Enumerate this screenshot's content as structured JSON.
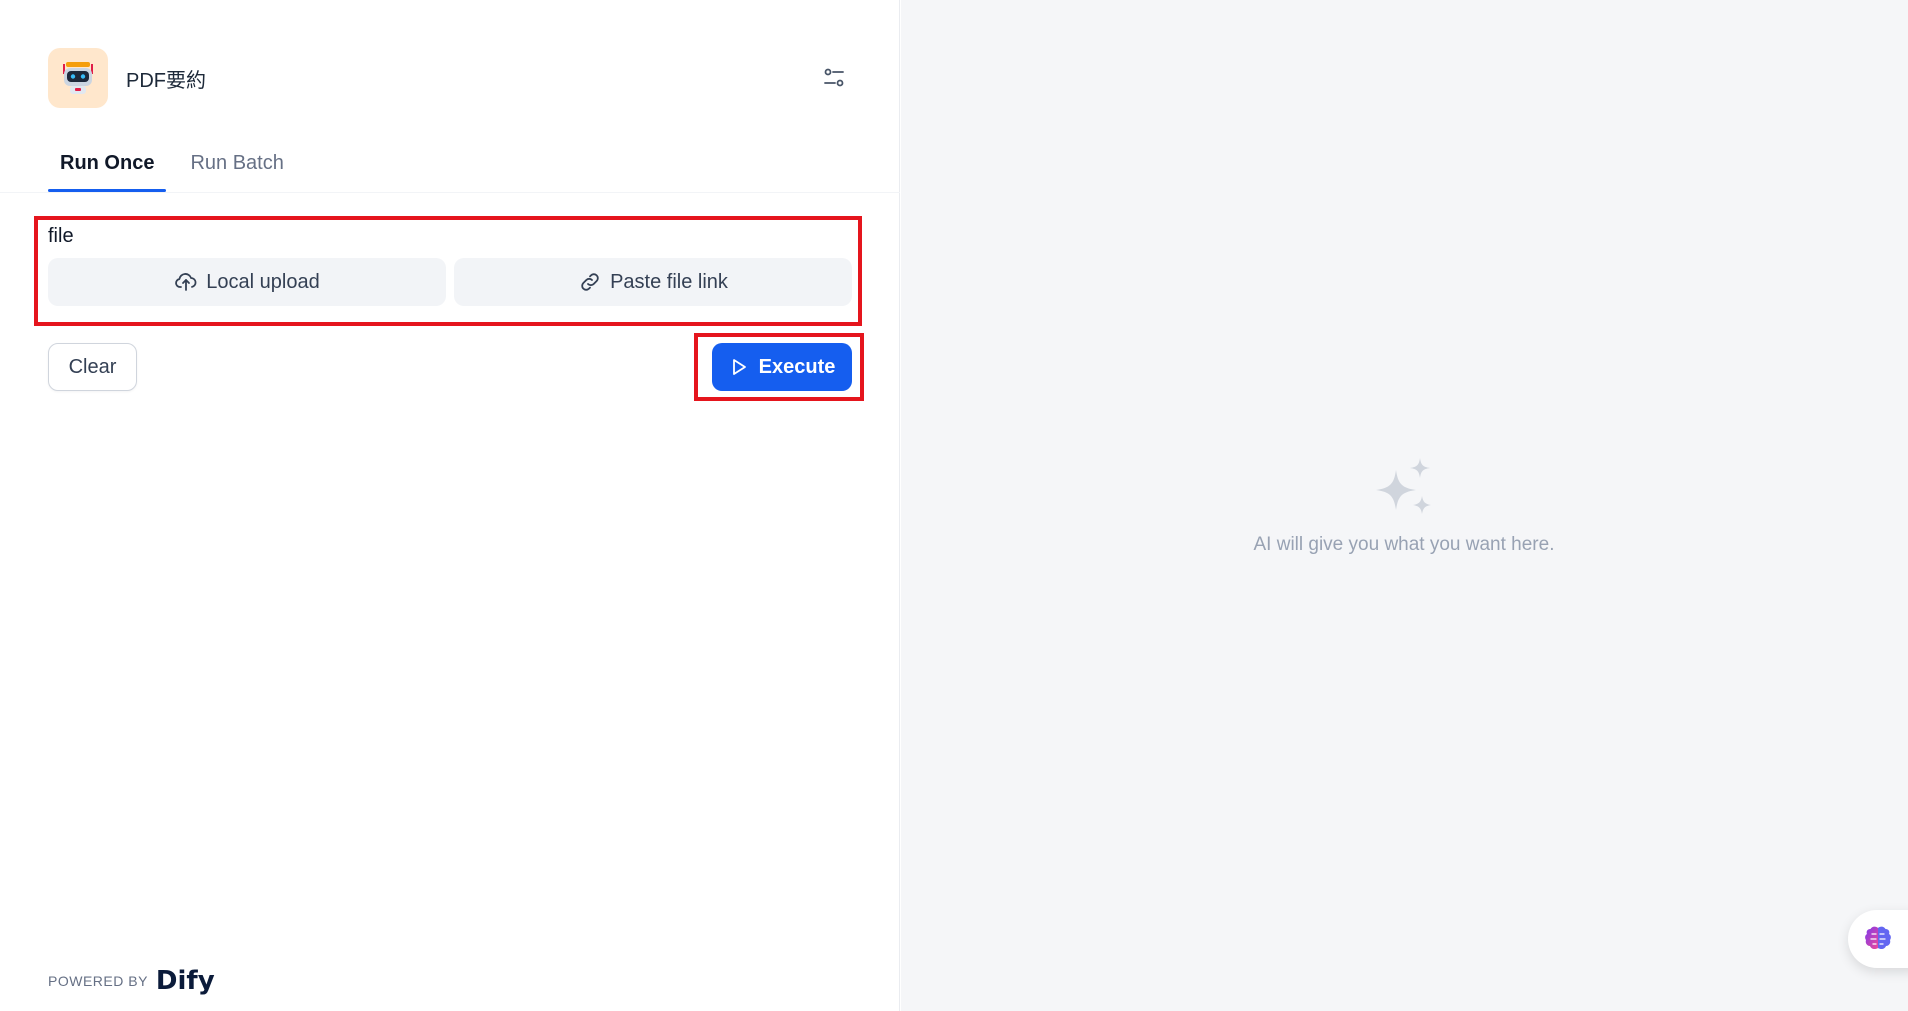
{
  "app": {
    "title": "PDF要約",
    "icon": "robot-icon"
  },
  "tabs": [
    {
      "label": "Run Once",
      "active": true
    },
    {
      "label": "Run Batch",
      "active": false
    }
  ],
  "form": {
    "field_label": "file",
    "local_upload_label": "Local upload",
    "paste_link_label": "Paste file link"
  },
  "actions": {
    "clear_label": "Clear",
    "execute_label": "Execute"
  },
  "footer": {
    "powered_by": "POWERED BY",
    "brand": "Dify"
  },
  "result": {
    "empty_text": "AI will give you what you want here."
  },
  "colors": {
    "accent": "#155eef",
    "highlight": "#e5151d",
    "right_bg": "#f5f6f8"
  }
}
